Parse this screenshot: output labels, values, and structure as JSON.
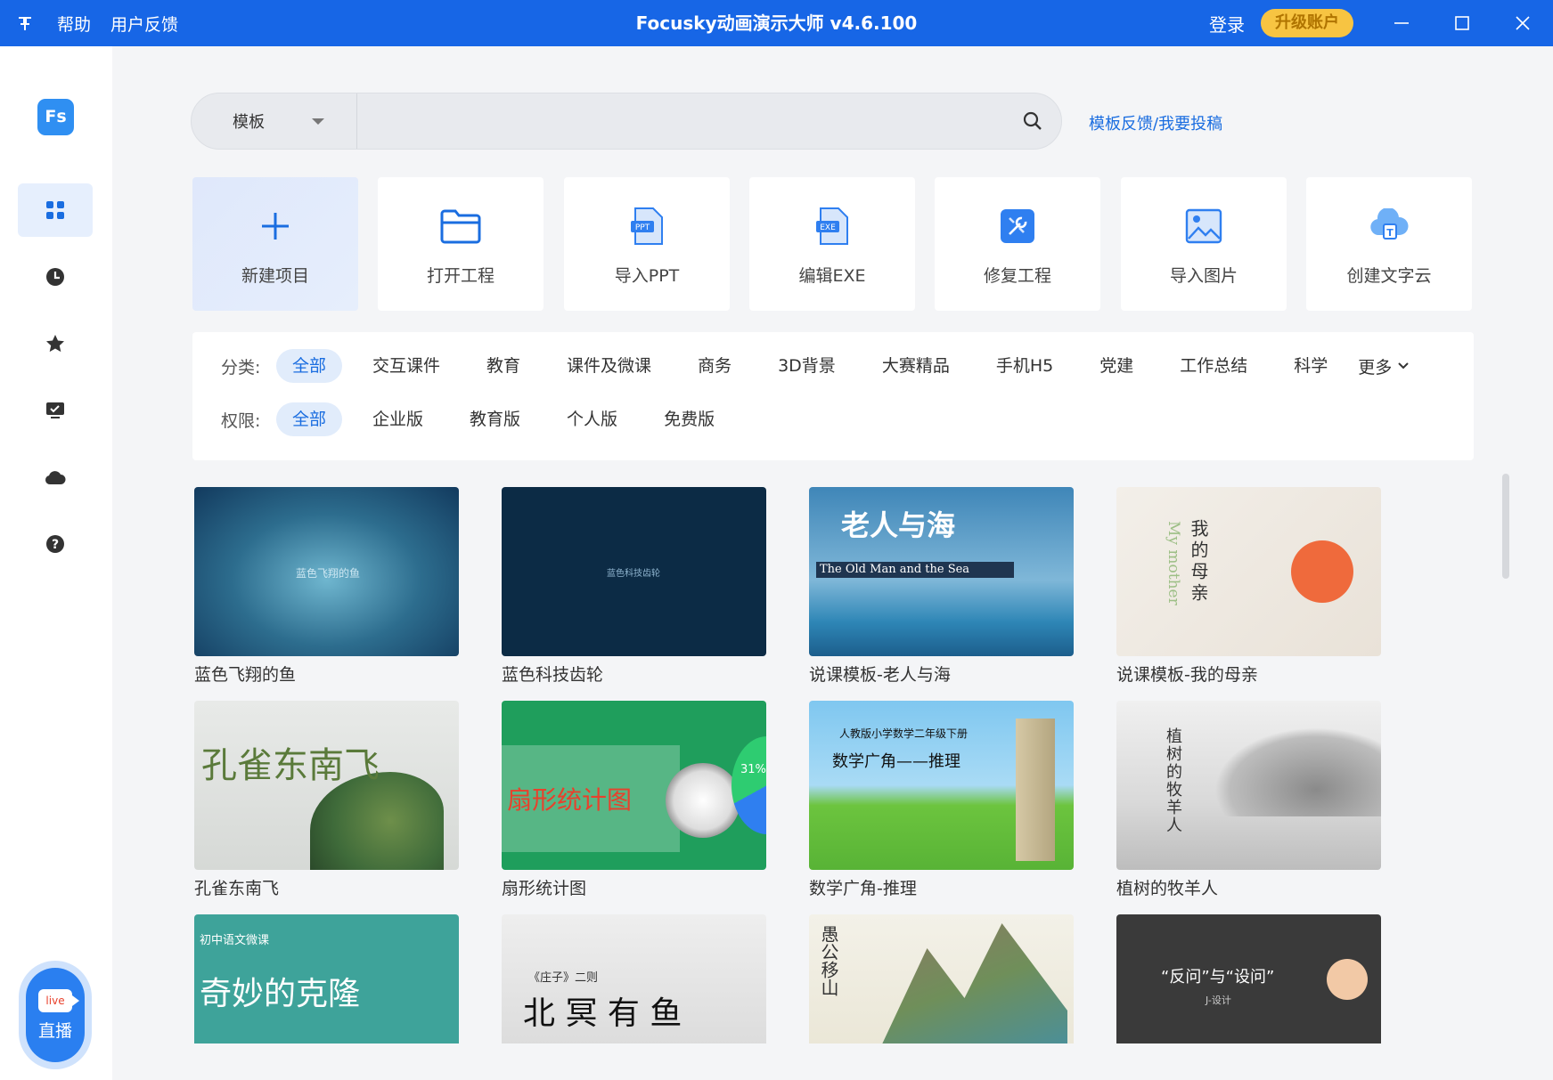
{
  "titlebar": {
    "left_items": [
      "帮助",
      "用户反馈"
    ],
    "title": "Focusky动画演示大师 v4.6.100",
    "login": "登录",
    "upgrade": "升级账户"
  },
  "sidebar": {
    "logo": "Fs",
    "items": [
      "grid-icon",
      "clock-icon",
      "star-icon",
      "monitor-icon",
      "cloud-icon",
      "help-icon"
    ],
    "live_label": "直播",
    "live_badge": "live"
  },
  "search": {
    "type_label": "模板",
    "value": "",
    "feedback_link": "模板反馈/我要投稿"
  },
  "actions": [
    {
      "label": "新建项目",
      "icon": "plus-icon"
    },
    {
      "label": "打开工程",
      "icon": "folder-icon"
    },
    {
      "label": "导入PPT",
      "icon": "ppt-icon",
      "badge": "PPT"
    },
    {
      "label": "编辑EXE",
      "icon": "exe-icon",
      "badge": "EXE"
    },
    {
      "label": "修复工程",
      "icon": "tools-icon"
    },
    {
      "label": "导入图片",
      "icon": "image-icon"
    },
    {
      "label": "创建文字云",
      "icon": "cloud-text-icon",
      "badge": "T"
    }
  ],
  "filters": {
    "category_label": "分类:",
    "categories": [
      "全部",
      "交互课件",
      "教育",
      "课件及微课",
      "商务",
      "3D背景",
      "大赛精品",
      "手机H5",
      "党建",
      "工作总结",
      "科学"
    ],
    "more": "更多",
    "permission_label": "权限:",
    "permissions": [
      "全部",
      "企业版",
      "教育版",
      "个人版",
      "免费版"
    ]
  },
  "templates": [
    {
      "caption": "蓝色飞翔的鱼",
      "thumb_text": "蓝色飞翔的鱼"
    },
    {
      "caption": "蓝色科技齿轮",
      "thumb_text": "蓝色科技齿轮"
    },
    {
      "caption": "说课模板-老人与海",
      "thumb_title": "老人与海",
      "thumb_sub": "The Old Man and the Sea"
    },
    {
      "caption": "说课模板-我的母亲",
      "thumb_title": "我的母亲",
      "thumb_sub": "My mother"
    },
    {
      "caption": "孔雀东南飞",
      "thumb_title": "孔雀东南飞"
    },
    {
      "caption": "扇形统计图",
      "thumb_title": "扇形统计图",
      "thumb_sub": "31%"
    },
    {
      "caption": "数学广角-推理",
      "thumb_title": "数学广角——推理",
      "thumb_sub": "人教版小学数学二年级下册"
    },
    {
      "caption": "植树的牧羊人",
      "thumb_title": "植树的牧羊人"
    },
    {
      "caption": "",
      "thumb_title": "奇妙的克隆",
      "thumb_sub": "初中语文微课"
    },
    {
      "caption": "",
      "thumb_title": "北 冥 有 鱼",
      "thumb_sub": "《庄子》二则"
    },
    {
      "caption": "",
      "thumb_title": "愚公移山"
    },
    {
      "caption": "",
      "thumb_title": "“反问”与“设问”",
      "thumb_sub": "J-设计"
    }
  ]
}
